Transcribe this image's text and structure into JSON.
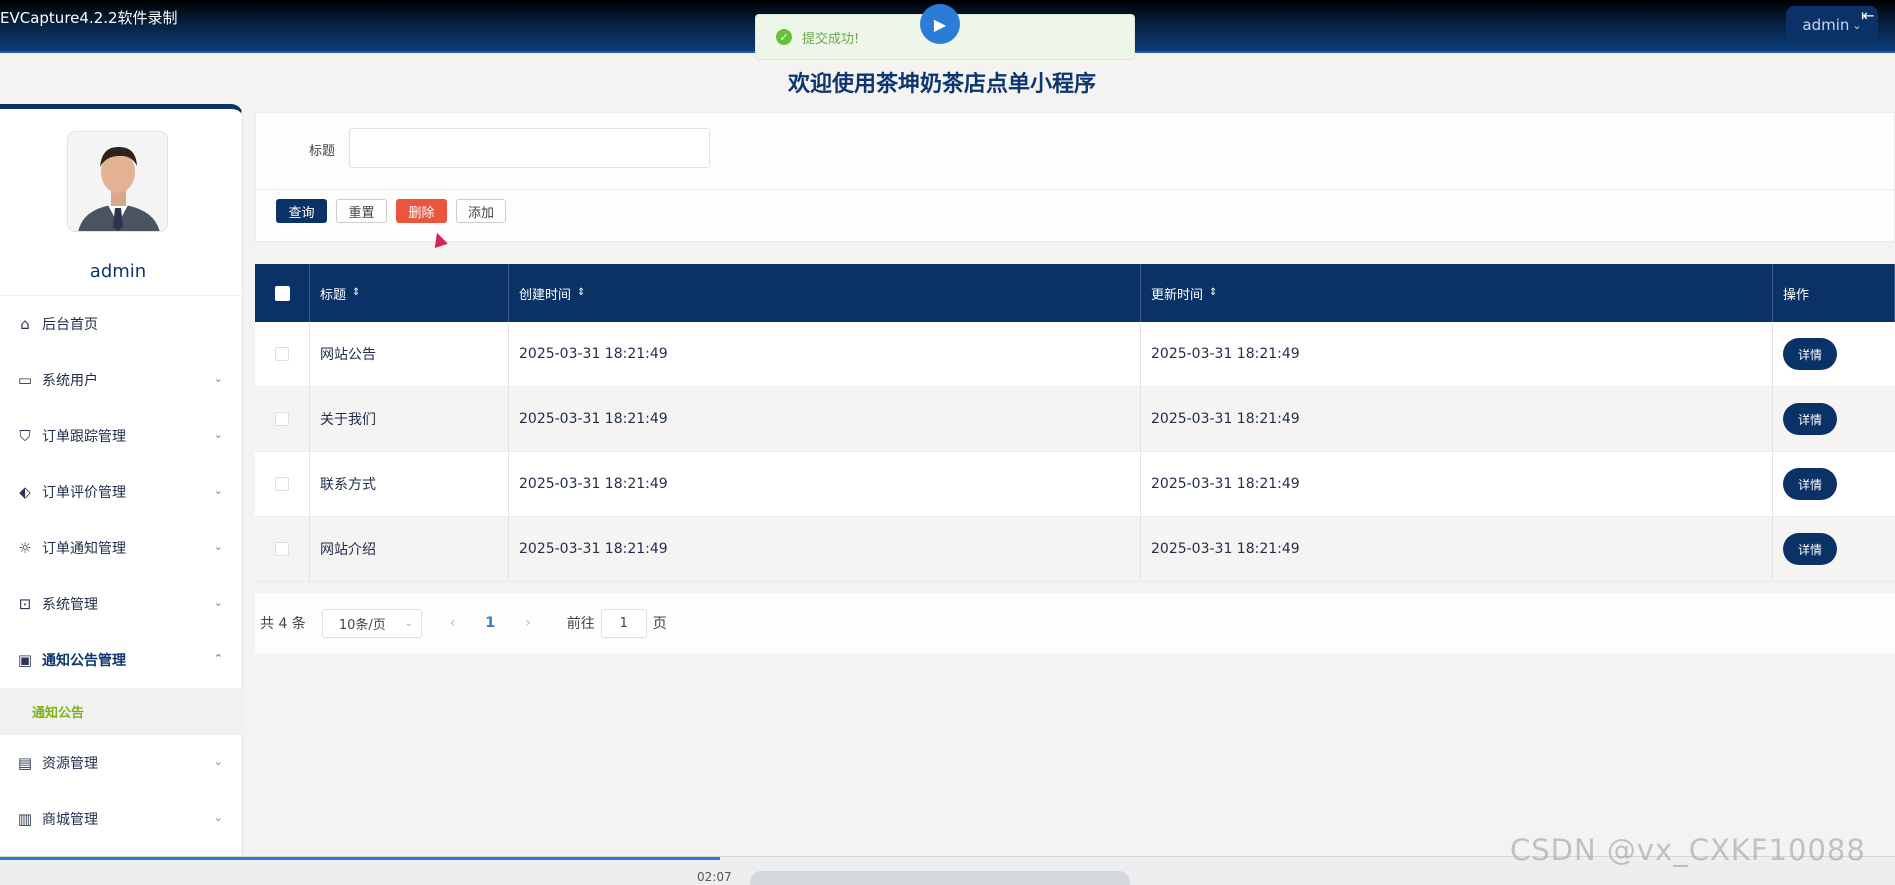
{
  "app": {
    "recorder_label": "EVCapture4.2.2软件录制",
    "user_menu": "admin",
    "page_title": "欢迎使用茶坤奶茶店点单小程序"
  },
  "toast": {
    "message": "提交成功!"
  },
  "sidebar": {
    "username": "admin",
    "items": [
      {
        "label": "后台首页",
        "icon": "home-icon"
      },
      {
        "label": "系统用户",
        "icon": "laptop-icon"
      },
      {
        "label": "订单跟踪管理",
        "icon": "bookmark-icon"
      },
      {
        "label": "订单评价管理",
        "icon": "tag-icon"
      },
      {
        "label": "订单通知管理",
        "icon": "sun-icon"
      },
      {
        "label": "系统管理",
        "icon": "inbox-icon"
      },
      {
        "label": "通知公告管理",
        "icon": "clipboard-icon"
      },
      {
        "label": "资源管理",
        "icon": "chat-icon"
      },
      {
        "label": "商城管理",
        "icon": "archive-icon"
      }
    ],
    "submenu_label": "通知公告"
  },
  "search": {
    "label": "标题",
    "value": "",
    "buttons": {
      "query": "查询",
      "reset": "重置",
      "delete": "删除",
      "add": "添加"
    }
  },
  "table": {
    "headers": [
      "标题",
      "创建时间",
      "更新时间",
      "操作"
    ],
    "rows": [
      {
        "title": "网站公告",
        "created": "2025-03-31 18:21:49",
        "updated": "2025-03-31 18:21:49",
        "action": "详情"
      },
      {
        "title": "关于我们",
        "created": "2025-03-31 18:21:49",
        "updated": "2025-03-31 18:21:49",
        "action": "详情"
      },
      {
        "title": "联系方式",
        "created": "2025-03-31 18:21:49",
        "updated": "2025-03-31 18:21:49",
        "action": "详情"
      },
      {
        "title": "网站介绍",
        "created": "2025-03-31 18:21:49",
        "updated": "2025-03-31 18:21:49",
        "action": "详情"
      }
    ]
  },
  "pagination": {
    "total": "共 4 条",
    "page_size": "10条/页",
    "current_page": "1",
    "goto_label": "前往",
    "goto_value": "1",
    "page_suffix": "页"
  },
  "player": {
    "time": "02:07"
  },
  "watermark": "CSDN @vx_CXKF10088",
  "colors": {
    "primary": "#0b3267",
    "danger": "#e9553d",
    "success": "#67c23a",
    "active_submenu": "#7ab317"
  }
}
